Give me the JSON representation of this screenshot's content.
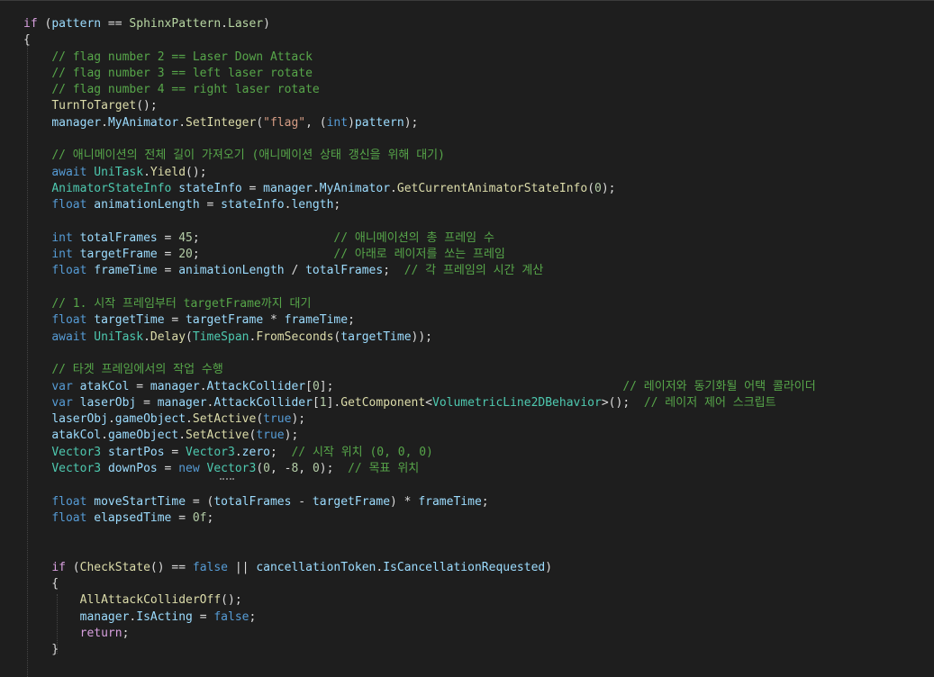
{
  "editor": {
    "lines": [
      [
        [
          "ctl",
          "if"
        ],
        [
          "tx",
          " ("
        ],
        [
          "va",
          "pattern"
        ],
        [
          "tx",
          " == "
        ],
        [
          "en",
          "SphinxPattern"
        ],
        [
          "tx",
          "."
        ],
        [
          "en",
          "Laser"
        ],
        [
          "tx",
          ")"
        ]
      ],
      [
        [
          "tx",
          "{"
        ]
      ],
      [
        [
          "tx",
          "    "
        ],
        [
          "cm",
          "// flag number 2 == Laser Down Attack"
        ]
      ],
      [
        [
          "tx",
          "    "
        ],
        [
          "cm",
          "// flag number 3 == left laser rotate"
        ]
      ],
      [
        [
          "tx",
          "    "
        ],
        [
          "cm",
          "// flag number 4 == right laser rotate"
        ]
      ],
      [
        [
          "tx",
          "    "
        ],
        [
          "mt",
          "TurnToTarget"
        ],
        [
          "tx",
          "();"
        ]
      ],
      [
        [
          "tx",
          "    "
        ],
        [
          "va",
          "manager"
        ],
        [
          "tx",
          "."
        ],
        [
          "va",
          "MyAnimator"
        ],
        [
          "tx",
          "."
        ],
        [
          "mt",
          "SetInteger"
        ],
        [
          "tx",
          "("
        ],
        [
          "st",
          "\"flag\""
        ],
        [
          "tx",
          ", ("
        ],
        [
          "kw",
          "int"
        ],
        [
          "tx",
          ")"
        ],
        [
          "va",
          "pattern"
        ],
        [
          "tx",
          ");"
        ]
      ],
      [
        [
          "tx",
          ""
        ]
      ],
      [
        [
          "tx",
          "    "
        ],
        [
          "cm",
          "// 애니메이션의 전체 길이 가져오기 (애니메이션 상태 갱신을 위해 대기)"
        ]
      ],
      [
        [
          "tx",
          "    "
        ],
        [
          "kw",
          "await"
        ],
        [
          "tx",
          " "
        ],
        [
          "ty",
          "UniTask"
        ],
        [
          "tx",
          "."
        ],
        [
          "mt",
          "Yield"
        ],
        [
          "tx",
          "();"
        ]
      ],
      [
        [
          "tx",
          "    "
        ],
        [
          "ty",
          "AnimatorStateInfo"
        ],
        [
          "tx",
          " "
        ],
        [
          "va",
          "stateInfo"
        ],
        [
          "tx",
          " = "
        ],
        [
          "va",
          "manager"
        ],
        [
          "tx",
          "."
        ],
        [
          "va",
          "MyAnimator"
        ],
        [
          "tx",
          "."
        ],
        [
          "mt",
          "GetCurrentAnimatorStateInfo"
        ],
        [
          "tx",
          "("
        ],
        [
          "nm",
          "0"
        ],
        [
          "tx",
          ");"
        ]
      ],
      [
        [
          "tx",
          "    "
        ],
        [
          "kw",
          "float"
        ],
        [
          "tx",
          " "
        ],
        [
          "va",
          "animationLength"
        ],
        [
          "tx",
          " = "
        ],
        [
          "va",
          "stateInfo"
        ],
        [
          "tx",
          "."
        ],
        [
          "va",
          "length"
        ],
        [
          "tx",
          ";"
        ]
      ],
      [
        [
          "tx",
          ""
        ]
      ],
      [
        [
          "tx",
          "    "
        ],
        [
          "kw",
          "int"
        ],
        [
          "tx",
          " "
        ],
        [
          "va",
          "totalFrames"
        ],
        [
          "tx",
          " = "
        ],
        [
          "nm",
          "45"
        ],
        [
          "tx",
          ";                   "
        ],
        [
          "cm",
          "// 애니메이션의 총 프레임 수"
        ]
      ],
      [
        [
          "tx",
          "    "
        ],
        [
          "kw",
          "int"
        ],
        [
          "tx",
          " "
        ],
        [
          "va",
          "targetFrame"
        ],
        [
          "tx",
          " = "
        ],
        [
          "nm",
          "20"
        ],
        [
          "tx",
          ";                   "
        ],
        [
          "cm",
          "// 아래로 레이저를 쏘는 프레임"
        ]
      ],
      [
        [
          "tx",
          "    "
        ],
        [
          "kw",
          "float"
        ],
        [
          "tx",
          " "
        ],
        [
          "va",
          "frameTime"
        ],
        [
          "tx",
          " = "
        ],
        [
          "va",
          "animationLength"
        ],
        [
          "tx",
          " / "
        ],
        [
          "va",
          "totalFrames"
        ],
        [
          "tx",
          ";  "
        ],
        [
          "cm",
          "// 각 프레임의 시간 계산"
        ]
      ],
      [
        [
          "tx",
          ""
        ]
      ],
      [
        [
          "tx",
          "    "
        ],
        [
          "cm",
          "// 1. 시작 프레임부터 targetFrame까지 대기"
        ]
      ],
      [
        [
          "tx",
          "    "
        ],
        [
          "kw",
          "float"
        ],
        [
          "tx",
          " "
        ],
        [
          "va",
          "targetTime"
        ],
        [
          "tx",
          " = "
        ],
        [
          "va",
          "targetFrame"
        ],
        [
          "tx",
          " * "
        ],
        [
          "va",
          "frameTime"
        ],
        [
          "tx",
          ";"
        ]
      ],
      [
        [
          "tx",
          "    "
        ],
        [
          "kw",
          "await"
        ],
        [
          "tx",
          " "
        ],
        [
          "ty",
          "UniTask"
        ],
        [
          "tx",
          "."
        ],
        [
          "mt",
          "Delay"
        ],
        [
          "tx",
          "("
        ],
        [
          "ty",
          "TimeSpan"
        ],
        [
          "tx",
          "."
        ],
        [
          "mt",
          "FromSeconds"
        ],
        [
          "tx",
          "("
        ],
        [
          "va",
          "targetTime"
        ],
        [
          "tx",
          "));"
        ]
      ],
      [
        [
          "tx",
          ""
        ]
      ],
      [
        [
          "tx",
          "    "
        ],
        [
          "cm",
          "// 타겟 프레임에서의 작업 수행"
        ]
      ],
      [
        [
          "tx",
          "    "
        ],
        [
          "kw",
          "var"
        ],
        [
          "tx",
          " "
        ],
        [
          "va",
          "atakCol"
        ],
        [
          "tx",
          " = "
        ],
        [
          "va",
          "manager"
        ],
        [
          "tx",
          "."
        ],
        [
          "va",
          "AttackCollider"
        ],
        [
          "tx",
          "["
        ],
        [
          "nm",
          "0"
        ],
        [
          "tx",
          "];                                         "
        ],
        [
          "cm",
          "// 레이저와 동기화될 어택 콜라이더"
        ]
      ],
      [
        [
          "tx",
          "    "
        ],
        [
          "kw",
          "var"
        ],
        [
          "tx",
          " "
        ],
        [
          "va",
          "laserObj"
        ],
        [
          "tx",
          " = "
        ],
        [
          "va",
          "manager"
        ],
        [
          "tx",
          "."
        ],
        [
          "va",
          "AttackCollider"
        ],
        [
          "tx",
          "["
        ],
        [
          "nm",
          "1"
        ],
        [
          "tx",
          "]."
        ],
        [
          "mt",
          "GetComponent"
        ],
        [
          "tx",
          "<"
        ],
        [
          "ty",
          "VolumetricLine2DBehavior"
        ],
        [
          "tx",
          ">();  "
        ],
        [
          "cm",
          "// 레이저 제어 스크립트"
        ]
      ],
      [
        [
          "tx",
          "    "
        ],
        [
          "va",
          "laserObj"
        ],
        [
          "tx",
          "."
        ],
        [
          "va",
          "gameObject"
        ],
        [
          "tx",
          "."
        ],
        [
          "mt",
          "SetActive"
        ],
        [
          "tx",
          "("
        ],
        [
          "kw",
          "true"
        ],
        [
          "tx",
          ");"
        ]
      ],
      [
        [
          "tx",
          "    "
        ],
        [
          "va",
          "atakCol"
        ],
        [
          "tx",
          "."
        ],
        [
          "va",
          "gameObject"
        ],
        [
          "tx",
          "."
        ],
        [
          "mt",
          "SetActive"
        ],
        [
          "tx",
          "("
        ],
        [
          "kw",
          "true"
        ],
        [
          "tx",
          ");"
        ]
      ],
      [
        [
          "tx",
          "    "
        ],
        [
          "ty",
          "Vector3"
        ],
        [
          "tx",
          " "
        ],
        [
          "va",
          "startPos"
        ],
        [
          "tx",
          " = "
        ],
        [
          "ty",
          "Vector3"
        ],
        [
          "tx",
          "."
        ],
        [
          "va",
          "zero"
        ],
        [
          "tx",
          ";  "
        ],
        [
          "cm",
          "// 시작 위치 (0, 0, 0)"
        ]
      ],
      [
        [
          "tx",
          "    "
        ],
        [
          "ty",
          "Vector3"
        ],
        [
          "tx",
          " "
        ],
        [
          "va",
          "downPos"
        ],
        [
          "tx",
          " = "
        ],
        [
          "kw",
          "new"
        ],
        [
          "tx",
          " "
        ],
        [
          "ty",
          "Vector3"
        ],
        [
          "tx",
          "("
        ],
        [
          "nm",
          "0"
        ],
        [
          "tx",
          ", -"
        ],
        [
          "nm",
          "8"
        ],
        [
          "tx",
          ", "
        ],
        [
          "nm",
          "0"
        ],
        [
          "tx",
          ");  "
        ],
        [
          "cm",
          "// 목표 위치"
        ]
      ],
      [
        [
          "tx",
          ""
        ]
      ],
      [
        [
          "tx",
          "    "
        ],
        [
          "kw",
          "float"
        ],
        [
          "tx",
          " "
        ],
        [
          "va",
          "moveStartTime"
        ],
        [
          "tx",
          " = ("
        ],
        [
          "va",
          "totalFrames"
        ],
        [
          "tx",
          " - "
        ],
        [
          "va",
          "targetFrame"
        ],
        [
          "tx",
          ") * "
        ],
        [
          "va",
          "frameTime"
        ],
        [
          "tx",
          ";"
        ]
      ],
      [
        [
          "tx",
          "    "
        ],
        [
          "kw",
          "float"
        ],
        [
          "tx",
          " "
        ],
        [
          "va",
          "elapsedTime"
        ],
        [
          "tx",
          " = "
        ],
        [
          "nm",
          "0f"
        ],
        [
          "tx",
          ";"
        ]
      ],
      [
        [
          "tx",
          ""
        ]
      ],
      [
        [
          "tx",
          ""
        ]
      ],
      [
        [
          "tx",
          "    "
        ],
        [
          "ctl",
          "if"
        ],
        [
          "tx",
          " ("
        ],
        [
          "mt",
          "CheckState"
        ],
        [
          "tx",
          "() == "
        ],
        [
          "kw",
          "false"
        ],
        [
          "tx",
          " || "
        ],
        [
          "va",
          "cancellationToken"
        ],
        [
          "tx",
          "."
        ],
        [
          "va",
          "IsCancellationRequested"
        ],
        [
          "tx",
          ")"
        ]
      ],
      [
        [
          "tx",
          "    {"
        ]
      ],
      [
        [
          "tx",
          "        "
        ],
        [
          "mt",
          "AllAttackColliderOff"
        ],
        [
          "tx",
          "();"
        ]
      ],
      [
        [
          "tx",
          "        "
        ],
        [
          "va",
          "manager"
        ],
        [
          "tx",
          "."
        ],
        [
          "va",
          "IsActing"
        ],
        [
          "tx",
          " = "
        ],
        [
          "kw",
          "false"
        ],
        [
          "tx",
          ";"
        ]
      ],
      [
        [
          "tx",
          "        "
        ],
        [
          "ctl",
          "return"
        ],
        [
          "tx",
          ";"
        ]
      ],
      [
        [
          "tx",
          "    }"
        ]
      ],
      [
        [
          "tx",
          ""
        ]
      ]
    ]
  }
}
